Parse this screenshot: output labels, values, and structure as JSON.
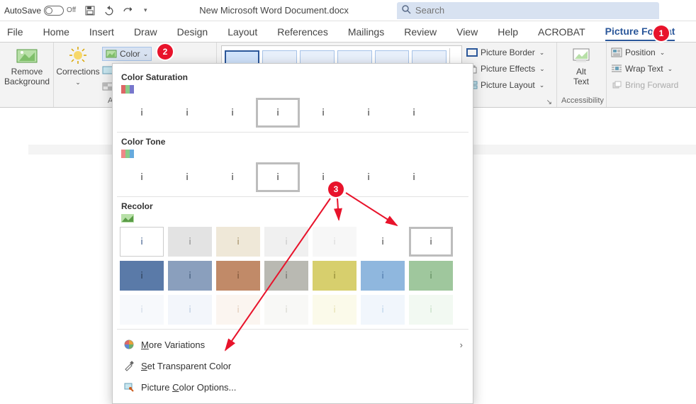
{
  "titlebar": {
    "autosave_label": "AutoSave",
    "autosave_state": "Off",
    "doc_title": "New Microsoft Word Document.docx",
    "search_placeholder": "Search"
  },
  "tabs": {
    "file": "File",
    "home": "Home",
    "insert": "Insert",
    "draw": "Draw",
    "design": "Design",
    "layout": "Layout",
    "references": "References",
    "mailings": "Mailings",
    "review": "Review",
    "view": "View",
    "help": "Help",
    "acrobat": "ACROBAT",
    "picture_format": "Picture Format"
  },
  "ribbon": {
    "remove_bg": "Remove Background",
    "corrections": "Corrections",
    "color": "Color",
    "adjust_group": "Ad",
    "picture_border": "Picture Border",
    "picture_effects": "Picture Effects",
    "picture_layout": "Picture Layout",
    "alt_text": "Alt Text",
    "accessibility_group": "Accessibility",
    "position": "Position",
    "wrap_text": "Wrap Text",
    "bring_forward": "Bring Forward"
  },
  "dropdown": {
    "color_saturation": "Color Saturation",
    "color_tone": "Color Tone",
    "recolor": "Recolor",
    "more_variations": "More Variations",
    "set_transparent": "Set Transparent Color",
    "picture_color_options": "Picture Color Options..."
  },
  "callouts": {
    "c1": "1",
    "c2": "2",
    "c3": "3"
  },
  "recolor_swatches": [
    {
      "bg": "#ffffff",
      "fig": "#3b5a8a",
      "orig": true
    },
    {
      "bg": "#e3e3e3",
      "fig": "#888"
    },
    {
      "bg": "#efe8d8",
      "fig": "#a08b60"
    },
    {
      "bg": "#f0f0f0",
      "fig": "#c7c7c7"
    },
    {
      "bg": "#f7f7f7",
      "fig": "#dcdcdc"
    },
    {
      "bg": "#ffffff",
      "fig": "#444"
    },
    {
      "bg": "#ffffff",
      "fig": "#444",
      "box": true
    },
    {
      "bg": "#5a7aa8",
      "fig": "#2c3e55"
    },
    {
      "bg": "#8a9fbd",
      "fig": "#3f5878"
    },
    {
      "bg": "#c18a68",
      "fig": "#7a5238"
    },
    {
      "bg": "#b9b9b2",
      "fig": "#6c6c66"
    },
    {
      "bg": "#d7cf6d",
      "fig": "#8b8432"
    },
    {
      "bg": "#8fb7de",
      "fig": "#4c77a8"
    },
    {
      "bg": "#9fc79d",
      "fig": "#5d8a5b"
    },
    {
      "bg": "#f7f9fc",
      "fig": "#cfd8e6"
    },
    {
      "bg": "#f3f6fb",
      "fig": "#b8c9de"
    },
    {
      "bg": "#fbf5f0",
      "fig": "#e0c9b6"
    },
    {
      "bg": "#f8f8f6",
      "fig": "#d7d7cf"
    },
    {
      "bg": "#fbfaea",
      "fig": "#e5e0b0"
    },
    {
      "bg": "#f1f6fc",
      "fig": "#b9d1ea"
    },
    {
      "bg": "#f2f9f2",
      "fig": "#c2dec1"
    }
  ]
}
